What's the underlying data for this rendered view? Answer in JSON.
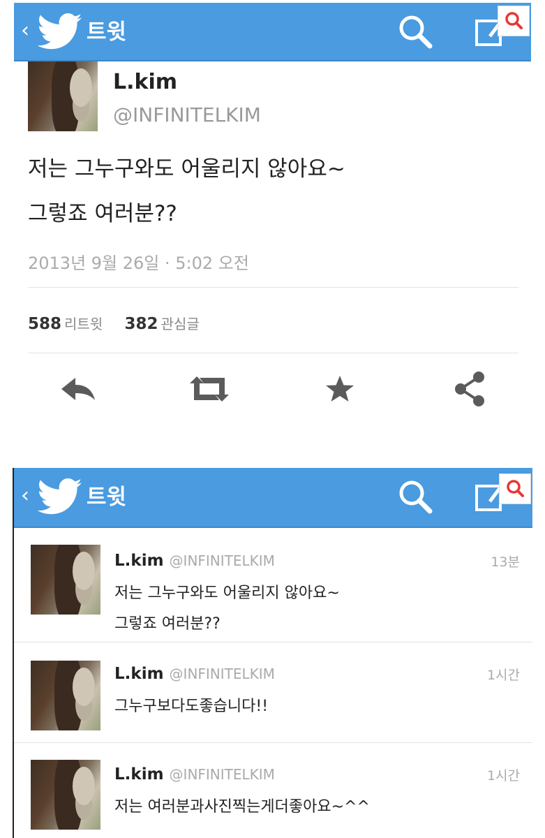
{
  "header": {
    "back": "‹",
    "title": "트윗"
  },
  "detail": {
    "name": "L.kim",
    "handle": "@INFINITELKIM",
    "text_line1": "저는 그누구와도 어울리지 않아요~",
    "text_line2": "그렇죠 여러분??",
    "date": "2013년 9월 26일 · 5:02 오전",
    "retweets": "588",
    "retweets_label": "리트윗",
    "favorites": "382",
    "favorites_label": "관심글"
  },
  "timeline": [
    {
      "name": "L.kim",
      "handle": "@INFINITELKIM",
      "time": "13분",
      "line1": "저는 그누구와도 어울리지 않아요~",
      "line2": "그렇죠 여러분??"
    },
    {
      "name": "L.kim",
      "handle": "@INFINITELKIM",
      "time": "1시간",
      "line1": "그누구보다도좋습니다!!",
      "line2": ""
    },
    {
      "name": "L.kim",
      "handle": "@INFINITELKIM",
      "time": "1시간",
      "line1": "저는 여러분과사진찍는게더좋아요~^^",
      "line2": ""
    }
  ],
  "colors": {
    "bar": "#4a9be0",
    "badge": "#e53935",
    "icon": "#5b5b5b"
  }
}
